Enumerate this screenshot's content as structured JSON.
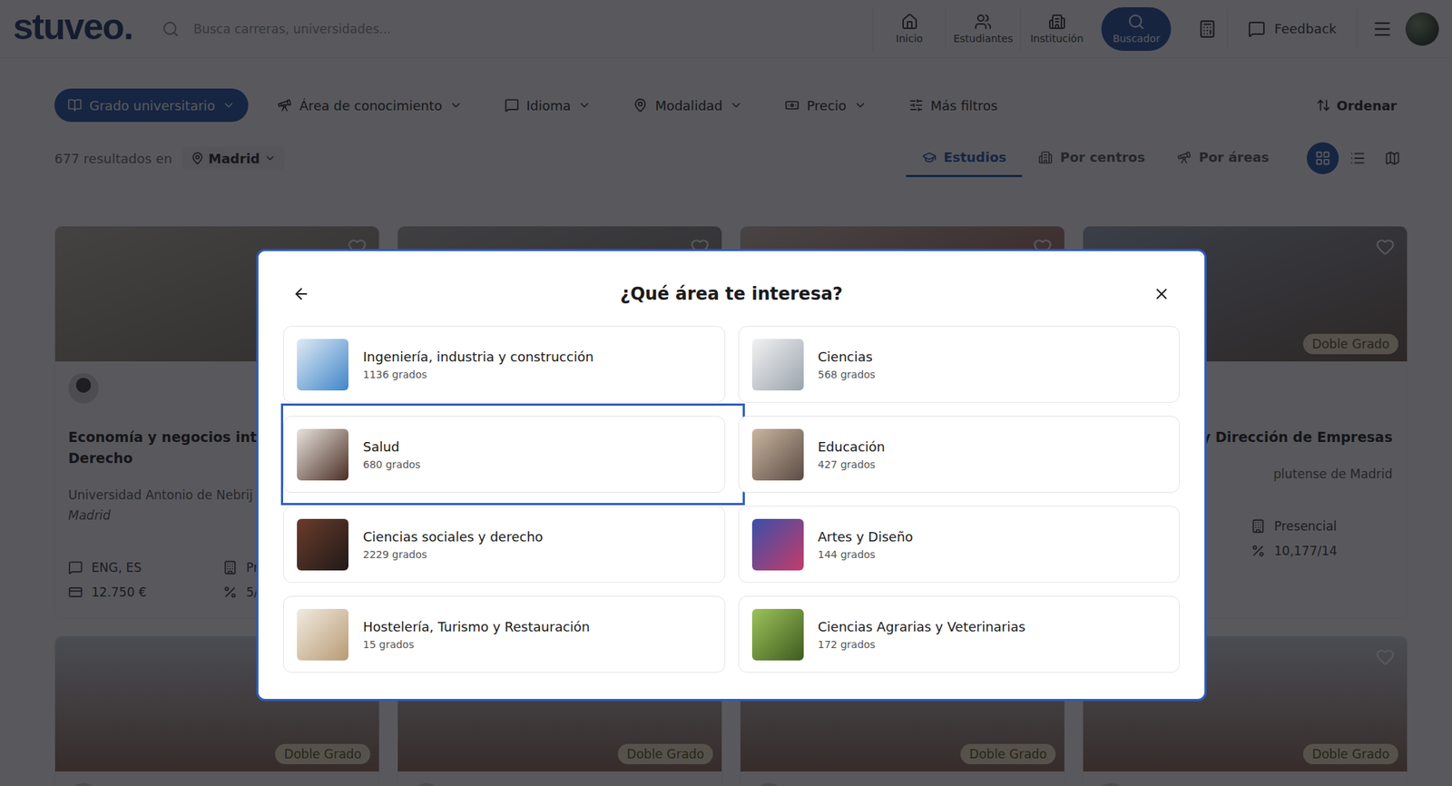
{
  "header": {
    "logo": "stuveo.",
    "search_placeholder": "Busca carreras, universidades...",
    "nav": [
      {
        "label": "Inicio",
        "kind": "home",
        "selected": false
      },
      {
        "label": "Estudiantes",
        "kind": "students",
        "selected": false
      },
      {
        "label": "Institución",
        "kind": "institution",
        "selected": false
      },
      {
        "label": "Buscador",
        "kind": "search",
        "selected": true
      }
    ],
    "feedback": "Feedback"
  },
  "filters": [
    {
      "label": "Grado universitario",
      "kind": "degree",
      "selected": true,
      "dropdown": true
    },
    {
      "label": "Área de conocimiento",
      "kind": "area",
      "selected": false,
      "dropdown": true
    },
    {
      "label": "Idioma",
      "kind": "language",
      "selected": false,
      "dropdown": true
    },
    {
      "label": "Modalidad",
      "kind": "modality",
      "selected": false,
      "dropdown": true
    },
    {
      "label": "Precio",
      "kind": "price",
      "selected": false,
      "dropdown": true
    },
    {
      "label": "Más filtros",
      "kind": "more",
      "selected": false,
      "dropdown": false
    }
  ],
  "sort": "Ordenar",
  "results": {
    "count_text": "677 resultados en",
    "location": "Madrid"
  },
  "view_tabs": [
    {
      "label": "Estudios",
      "kind": "studies",
      "selected": true
    },
    {
      "label": "Por centros",
      "kind": "centers",
      "selected": false
    },
    {
      "label": "Por áreas",
      "kind": "areas",
      "selected": false
    }
  ],
  "view_modes": [
    {
      "kind": "grid",
      "selected": true
    },
    {
      "kind": "list",
      "selected": false
    },
    {
      "kind": "map",
      "selected": false
    }
  ],
  "cards": [
    {
      "favorite": false,
      "title_lines": [
        "Economía y negocios inter",
        "Derecho"
      ],
      "university": "Universidad Antonio de Nebrij",
      "city": "Madrid",
      "meta": [
        {
          "kind": "language",
          "text": "ENG, ES"
        },
        {
          "kind": "modality",
          "text": "Pr"
        },
        {
          "kind": "price",
          "text": "12.750 €"
        },
        {
          "kind": "cutoff",
          "text": "5/"
        }
      ]
    },
    {
      "favorite": false
    },
    {
      "favorite": false
    },
    {
      "favorite": false,
      "badge": "Doble Grado",
      "title_lines": [
        "y Dirección de Empresas"
      ],
      "university": "plutense de Madrid",
      "meta": [
        {
          "kind": "modality",
          "text": "Presencial"
        },
        {
          "kind": "cutoff",
          "text": "10,177/14"
        }
      ]
    },
    {
      "favorite": false,
      "badge": "Doble Grado"
    },
    {
      "favorite": false,
      "badge": "Doble Grado"
    },
    {
      "favorite": false,
      "badge": "Doble Grado"
    },
    {
      "favorite": false,
      "badge": "Doble Grado"
    }
  ],
  "modal": {
    "title": "¿Qué área te interesa?",
    "areas": [
      {
        "name": "Ingeniería, industria y construcción",
        "count": "1136 grados",
        "highlighted": false
      },
      {
        "name": "Ciencias",
        "count": "568 grados",
        "highlighted": false
      },
      {
        "name": "Salud",
        "count": "680 grados",
        "highlighted": true
      },
      {
        "name": "Educación",
        "count": "427 grados",
        "highlighted": false
      },
      {
        "name": "Ciencias sociales y derecho",
        "count": "2229 grados",
        "highlighted": false
      },
      {
        "name": "Artes y Diseño",
        "count": "144 grados",
        "highlighted": false
      },
      {
        "name": "Hostelería, Turismo y Restauración",
        "count": "15 grados",
        "highlighted": false
      },
      {
        "name": "Ciencias Agrarias y Veterinarias",
        "count": "172 grados",
        "highlighted": false
      }
    ]
  }
}
